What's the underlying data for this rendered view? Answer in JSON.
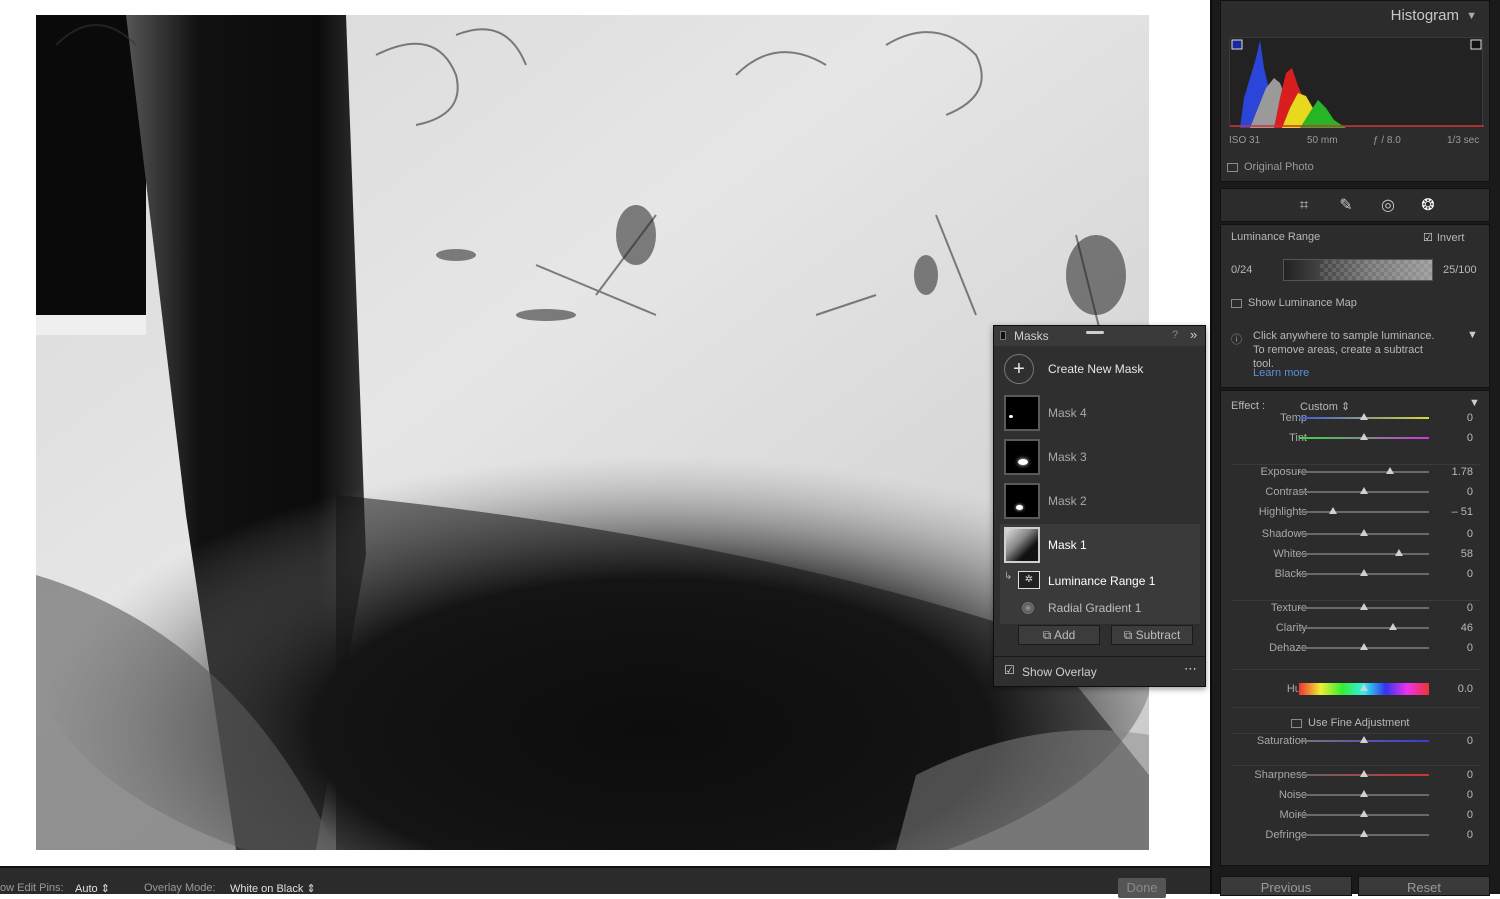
{
  "toolbar": {
    "edit_pins_label": "ow Edit Pins:",
    "edit_pins_value": "Auto",
    "overlay_mode_label": "Overlay Mode:",
    "overlay_mode_value": "White on Black",
    "done_label": "Done"
  },
  "histogram": {
    "title": "Histogram",
    "iso": "ISO 31",
    "focal": "50 mm",
    "aperture": "ƒ / 8.0",
    "shutter": "1/3 sec",
    "original_photo_label": "Original Photo"
  },
  "tools": [
    "crop-icon",
    "healing-icon",
    "red-eye-icon",
    "masking-icon"
  ],
  "mask_settings": {
    "title": "Luminance Range",
    "invert_label": "Invert",
    "invert_checked": true,
    "range_low": "0/24",
    "range_high": "25/100",
    "show_map_label": "Show Luminance Map",
    "hint": "Click anywhere to sample luminance. To remove areas, create a subtract tool.",
    "learn_more": "Learn more"
  },
  "effect": {
    "label": "Effect :",
    "preset": "Custom",
    "sliders": [
      {
        "name": "Temp",
        "value": "0",
        "pos": 0.5
      },
      {
        "name": "Tint",
        "value": "0",
        "pos": 0.5
      },
      {
        "name": "Exposure",
        "value": "1.78",
        "pos": 0.7
      },
      {
        "name": "Contrast",
        "value": "0",
        "pos": 0.5
      },
      {
        "name": "Highlights",
        "value": "– 51",
        "pos": 0.26
      },
      {
        "name": "Shadows",
        "value": "0",
        "pos": 0.5
      },
      {
        "name": "Whites",
        "value": "58",
        "pos": 0.77
      },
      {
        "name": "Blacks",
        "value": "0",
        "pos": 0.5
      },
      {
        "name": "Texture",
        "value": "0",
        "pos": 0.5
      },
      {
        "name": "Clarity",
        "value": "46",
        "pos": 0.72
      },
      {
        "name": "Dehaze",
        "value": "0",
        "pos": 0.5
      },
      {
        "name": "Hue",
        "value": "0.0",
        "pos": 0.5
      },
      {
        "name": "Saturation",
        "value": "0",
        "pos": 0.5
      },
      {
        "name": "Sharpness",
        "value": "0",
        "pos": 0.5
      },
      {
        "name": "Noise",
        "value": "0",
        "pos": 0.5
      },
      {
        "name": "Moiré",
        "value": "0",
        "pos": 0.5
      },
      {
        "name": "Defringe",
        "value": "0",
        "pos": 0.5
      }
    ],
    "fine_adjust_label": "Use Fine Adjustment"
  },
  "footer": {
    "previous": "Previous",
    "reset": "Reset"
  },
  "masks_panel": {
    "title": "Masks",
    "create_new": "Create New Mask",
    "masks": [
      "Mask 4",
      "Mask 3",
      "Mask 2",
      "Mask 1"
    ],
    "selected_mask": "Mask 1",
    "components": [
      "Luminance Range 1",
      "Radial Gradient 1"
    ],
    "add_label": "Add",
    "subtract_label": "Subtract",
    "show_overlay_label": "Show Overlay",
    "show_overlay_checked": true
  }
}
